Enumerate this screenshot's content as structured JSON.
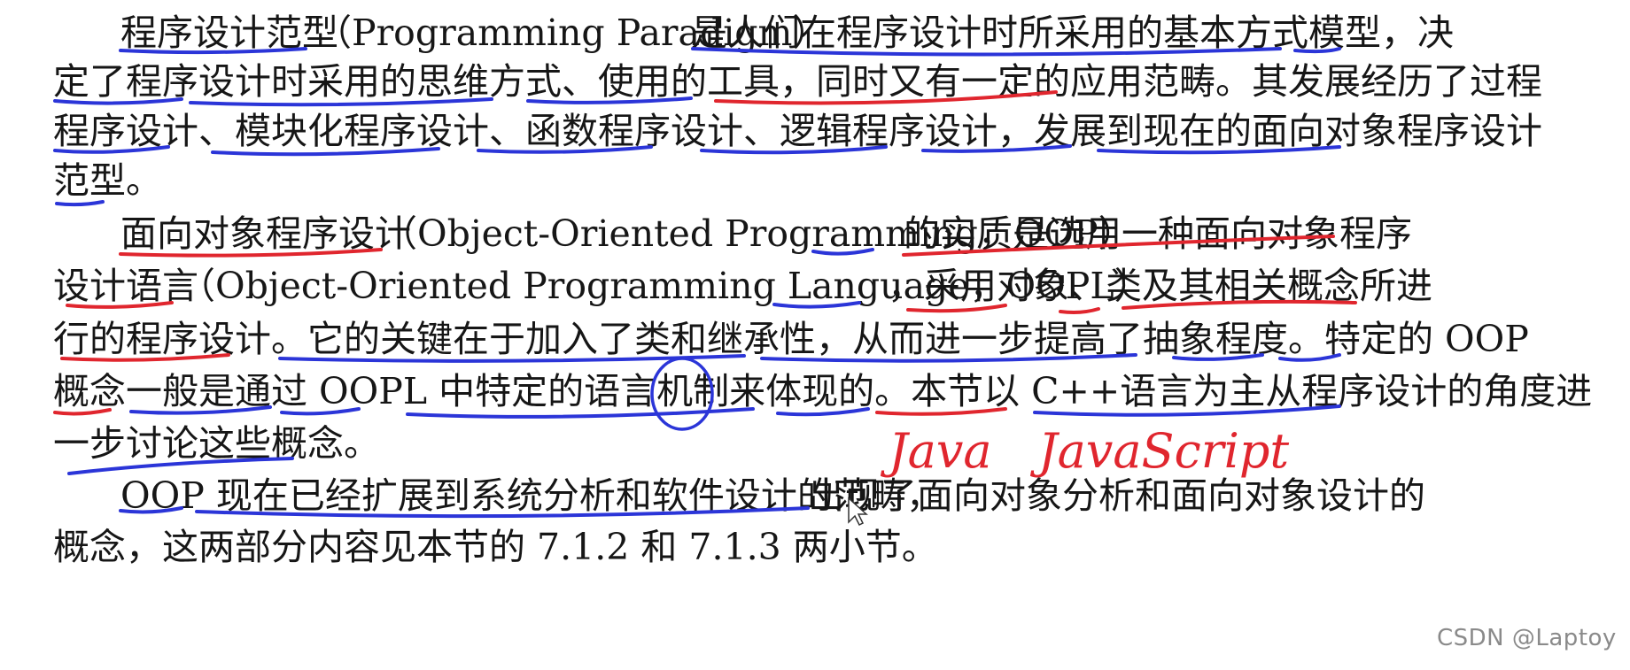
{
  "document": {
    "lines": [
      {
        "segments": [
          "程序设计范型",
          "（Programming Paradigm）",
          "是人们在程序设计时所采用的基本方式模型，决"
        ]
      },
      {
        "segments": [
          "定了程序设计时采用的思维方式、使用的工具，同时又有一定的应用范畴。其发展经历了过程"
        ]
      },
      {
        "segments": [
          "程序设计、模块化程序设计、函数程序设计、逻辑程序设计，发展到现在的面向对象程序设计"
        ]
      },
      {
        "segments": [
          "范型。"
        ]
      },
      {
        "segments": [
          "面向对象程序设计",
          "（Object-Oriented Programming，OOP）",
          "的实质是选用一种面向对象程序"
        ]
      },
      {
        "segments": [
          "设计语言",
          "（Object-Oriented Programming Language，OOPL）",
          "，采用对象、类及其相关概念所进"
        ]
      },
      {
        "segments": [
          "行的程序设计。它的关键在于加入了类和继承性，从而进一步提高了抽象程度。特定的 OOP"
        ]
      },
      {
        "segments": [
          "概念一般是通过 OOPL 中特定的语言机制来体现的。本节以 C++语言为主从程序设计的角度进"
        ]
      },
      {
        "segments": [
          "一步讨论这些概念。"
        ]
      },
      {
        "segments": [
          "OOP 现在已经扩展到系统分析和软件设计的范畴，",
          "出现了面向对象分析和面向对象设计的"
        ]
      },
      {
        "segments": [
          "概念，这两部分内容见本节的 7.1.2 和 7.1.3 两小节。"
        ]
      }
    ]
  },
  "handwriting": {
    "note1": "Java",
    "note2": "JavaScript",
    "colors": {
      "blue": "#2b35d8",
      "red": "#e0262e"
    }
  },
  "watermark": "CSDN @Laptoy"
}
